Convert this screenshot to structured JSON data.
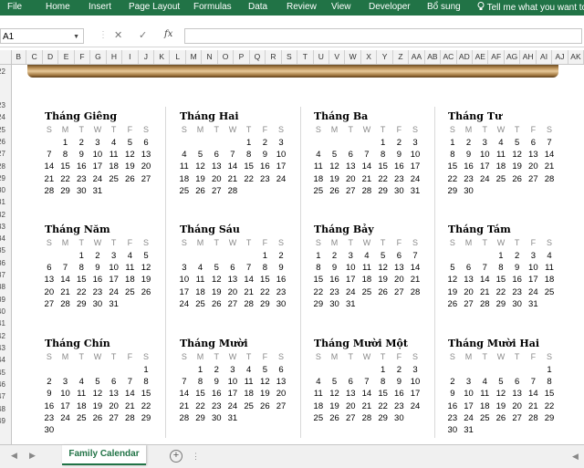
{
  "ribbon": {
    "tabs": [
      "File",
      "Home",
      "Insert",
      "Page Layout",
      "Formulas",
      "Data",
      "Review",
      "View",
      "Developer",
      "Bổ sung"
    ],
    "tell_me": "Tell me what you want to"
  },
  "formula_bar": {
    "name_box": "A1",
    "cancel_glyph": "✕",
    "enter_glyph": "✓",
    "fx_glyph": "fx",
    "formula_value": ""
  },
  "columns": [
    "B",
    "C",
    "D",
    "E",
    "F",
    "G",
    "H",
    "I",
    "J",
    "K",
    "L",
    "M",
    "N",
    "O",
    "P",
    "Q",
    "R",
    "S",
    "T",
    "U",
    "V",
    "W",
    "X",
    "Y",
    "Z",
    "AA",
    "AB",
    "AC",
    "AD",
    "AE",
    "AF",
    "AG",
    "AH",
    "AI",
    "AJ",
    "AK"
  ],
  "rows": [
    "22",
    "",
    "23",
    "24",
    "25",
    "26",
    "27",
    "28",
    "29",
    "30",
    "31",
    "32",
    "33",
    "34",
    "35",
    "36",
    "37",
    "38",
    "39",
    "40",
    "41",
    "42",
    "43",
    "44",
    "45",
    "46",
    "47",
    "48",
    "49"
  ],
  "day_headers": [
    "S",
    "M",
    "T",
    "W",
    "T",
    "F",
    "S"
  ],
  "months": [
    {
      "name": "Tháng Giêng",
      "start": 1,
      "days": 31
    },
    {
      "name": "Tháng Hai",
      "start": 4,
      "days": 28
    },
    {
      "name": "Tháng Ba",
      "start": 4,
      "days": 31
    },
    {
      "name": "Tháng Tư",
      "start": 0,
      "days": 30
    },
    {
      "name": "Tháng Năm",
      "start": 2,
      "days": 31
    },
    {
      "name": "Tháng Sáu",
      "start": 5,
      "days": 30
    },
    {
      "name": "Tháng Bảy",
      "start": 0,
      "days": 31
    },
    {
      "name": "Tháng Tám",
      "start": 3,
      "days": 31
    },
    {
      "name": "Tháng Chín",
      "start": 6,
      "days": 30
    },
    {
      "name": "Tháng Mười",
      "start": 1,
      "days": 31
    },
    {
      "name": "Tháng Mười Một",
      "start": 4,
      "days": 30
    },
    {
      "name": "Tháng Mười Hai",
      "start": 6,
      "days": 31
    }
  ],
  "sheet_tab": {
    "label": "Family Calendar"
  },
  "add_sheet_glyph": "+",
  "colors": {
    "excel_green": "#217346",
    "weekday_header": "#8a8a8a"
  }
}
